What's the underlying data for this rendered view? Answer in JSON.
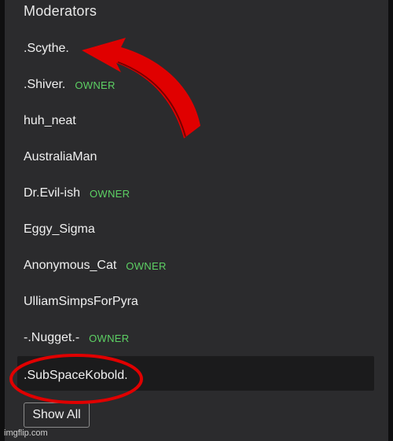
{
  "panel": {
    "title": "Moderators"
  },
  "moderators": [
    {
      "name": ".Scythe.",
      "badge": ""
    },
    {
      "name": ".Shiver.",
      "badge": "OWNER"
    },
    {
      "name": "huh_neat",
      "badge": ""
    },
    {
      "name": "AustraliaMan",
      "badge": ""
    },
    {
      "name": "Dr.Evil-ish",
      "badge": "OWNER"
    },
    {
      "name": "Eggy_Sigma",
      "badge": ""
    },
    {
      "name": "Anonymous_Cat",
      "badge": "OWNER"
    },
    {
      "name": "UlliamSimpsForPyra",
      "badge": ""
    },
    {
      "name": "-.Nugget.-",
      "badge": "OWNER"
    },
    {
      "name": ".SubSpaceKobold.",
      "badge": ""
    }
  ],
  "show_all_label": "Show All",
  "watermark": "imgflip.com",
  "colors": {
    "panel_background": "#2b2b2d",
    "owner_badge": "#5dd164",
    "annotation": "#e00000"
  }
}
